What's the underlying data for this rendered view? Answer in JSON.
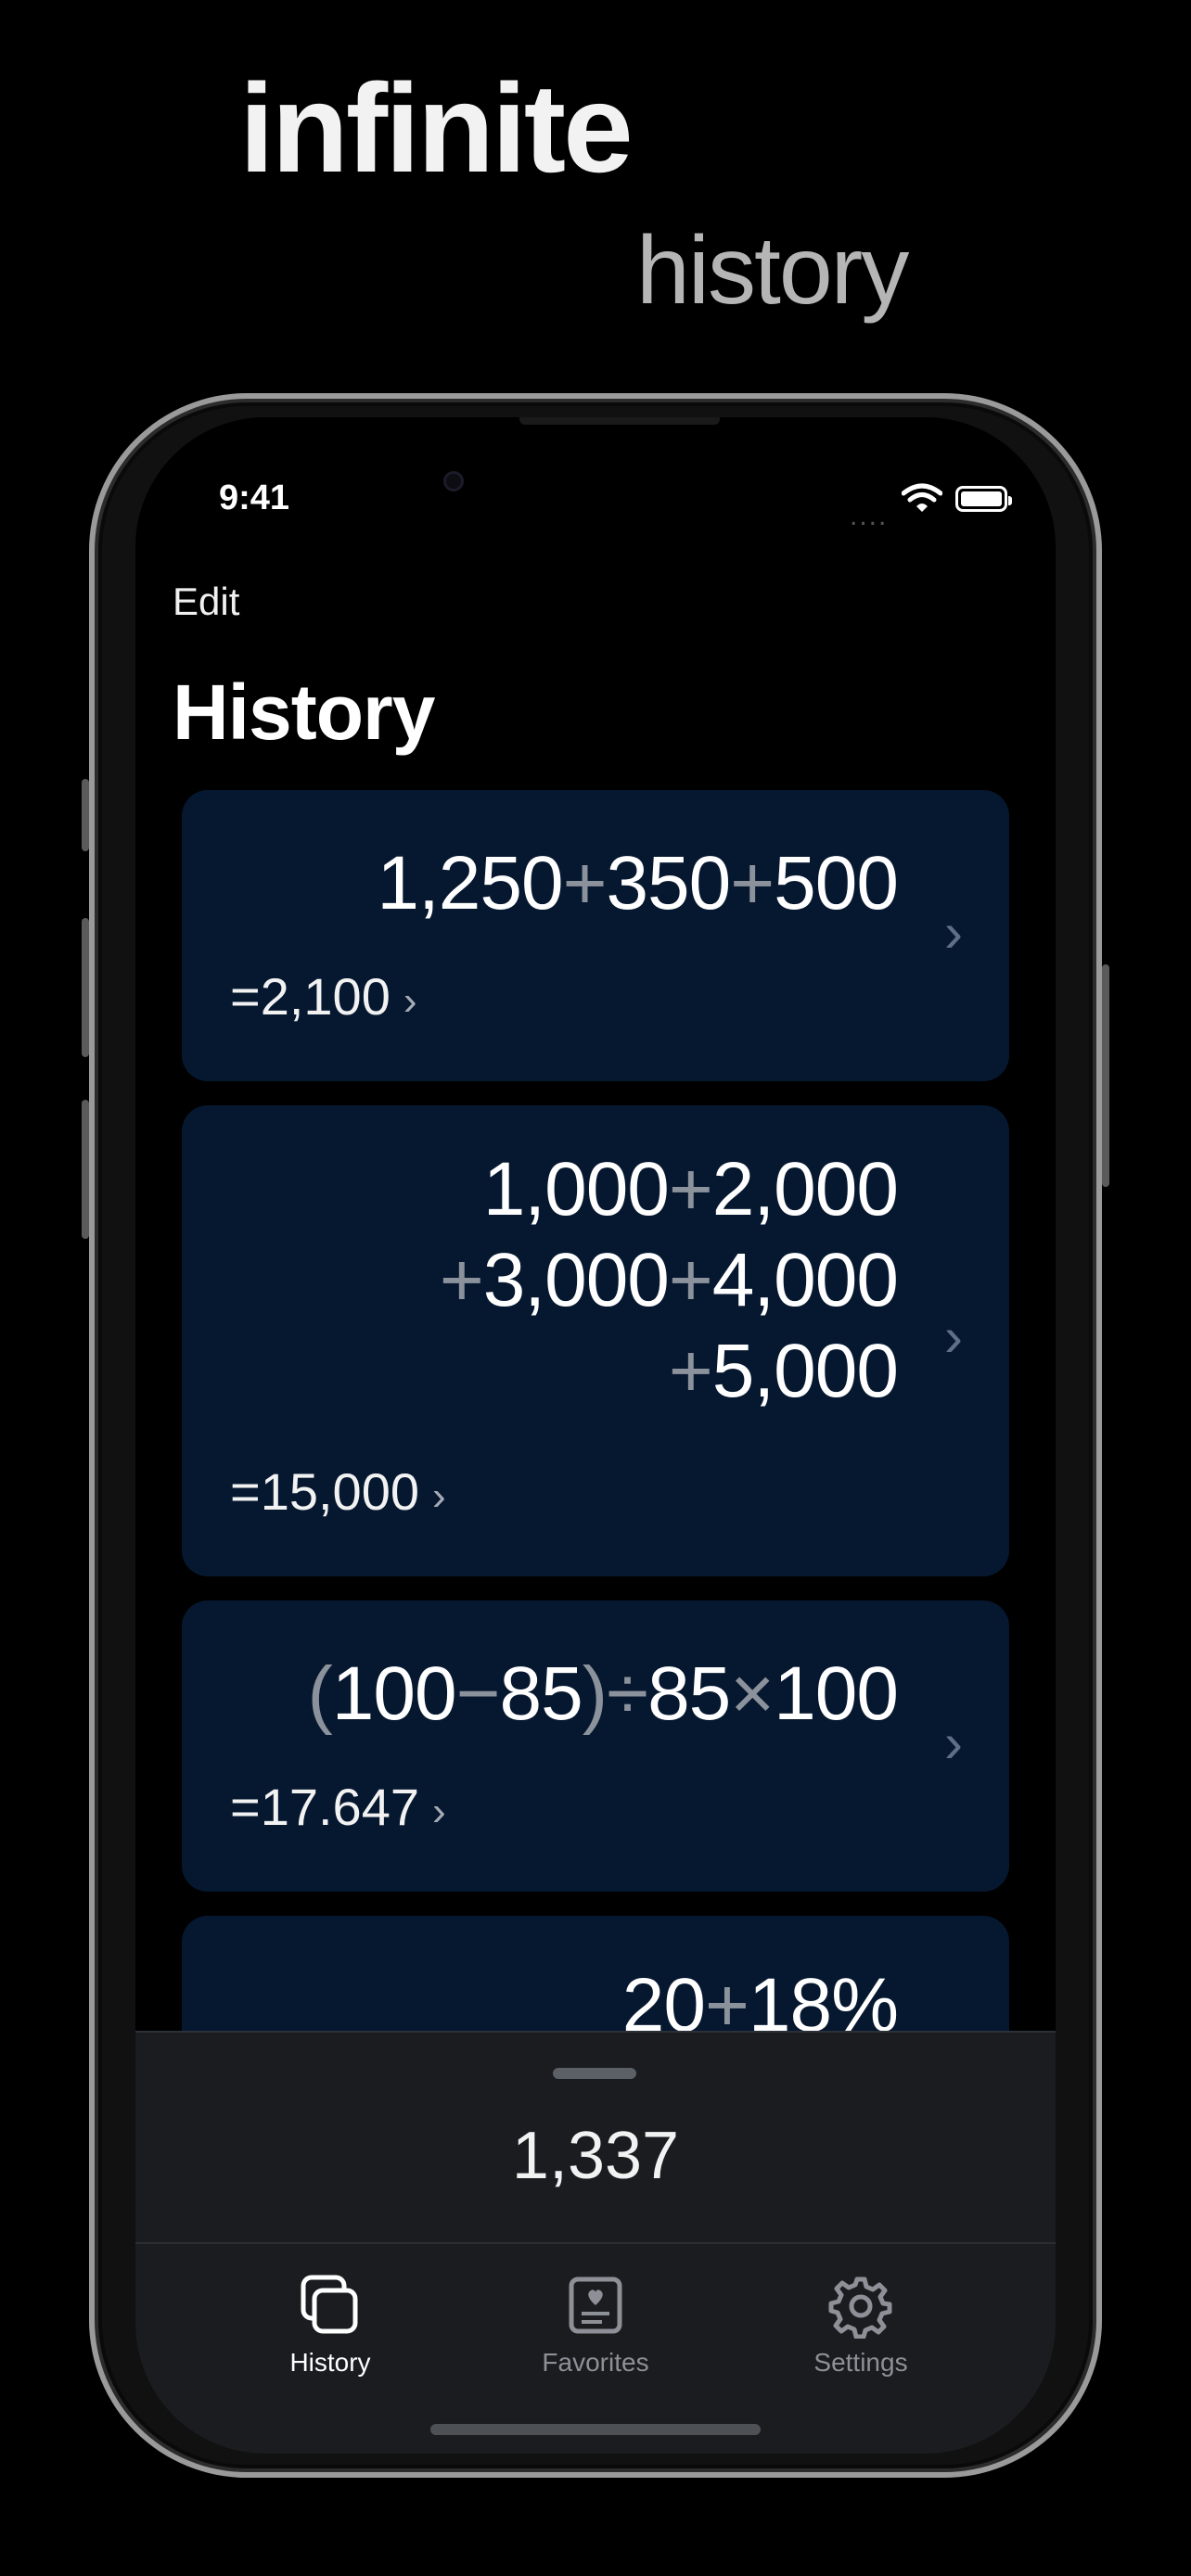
{
  "headline": {
    "line1": "infinite",
    "line2": "history"
  },
  "status_bar": {
    "time": "9:41",
    "signal": "...."
  },
  "nav": {
    "edit_label": "Edit",
    "title": "History"
  },
  "cards": [
    {
      "expr_lines": [
        [
          [
            "1,250",
            "n"
          ],
          [
            "+",
            "o"
          ],
          [
            "350",
            "n"
          ],
          [
            "+",
            "o"
          ],
          [
            "500",
            "n"
          ]
        ]
      ],
      "result": "=2,100"
    },
    {
      "expr_lines": [
        [
          [
            "1,000",
            "n"
          ],
          [
            "+",
            "o"
          ],
          [
            "2,000",
            "n"
          ]
        ],
        [
          [
            "+",
            "o"
          ],
          [
            "3,000",
            "n"
          ],
          [
            "+",
            "o"
          ],
          [
            "4,000",
            "n"
          ]
        ],
        [
          [
            "+",
            "o"
          ],
          [
            "5,000",
            "n"
          ]
        ]
      ],
      "result": "=15,000"
    },
    {
      "expr_lines": [
        [
          [
            "(",
            "o"
          ],
          [
            "100",
            "n"
          ],
          [
            "−",
            "o"
          ],
          [
            "85",
            "n"
          ],
          [
            ")",
            "o"
          ],
          [
            "÷",
            "o"
          ],
          [
            "85",
            "n"
          ],
          [
            "×",
            "o"
          ],
          [
            "100",
            "n"
          ]
        ]
      ],
      "result": "=17.647"
    },
    {
      "expr_lines": [
        [
          [
            "20",
            "n"
          ],
          [
            "+",
            "o"
          ],
          [
            "18%",
            "n"
          ]
        ]
      ],
      "result": ""
    }
  ],
  "panel": {
    "display_value": "1,337"
  },
  "tabs": [
    {
      "label": "History",
      "icon": "history-icon",
      "active": true
    },
    {
      "label": "Favorites",
      "icon": "favorites-icon",
      "active": false
    },
    {
      "label": "Settings",
      "icon": "gear-icon",
      "active": false
    }
  ],
  "colors": {
    "card_bg": "#061830",
    "operator": "#8c929c",
    "inactive_tab": "#8d9096"
  }
}
